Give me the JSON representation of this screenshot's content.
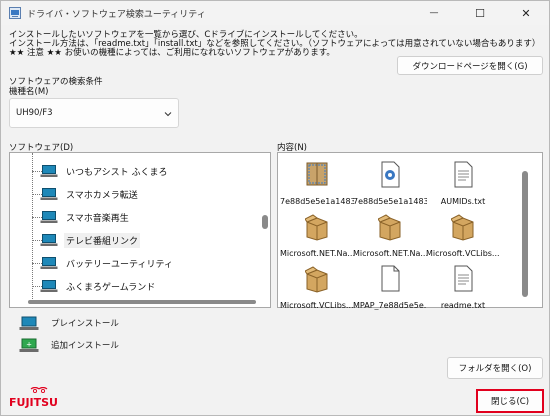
{
  "window": {
    "title": "ドライバ・ソフトウェア検索ユーティリティ",
    "minimize_glyph": "—",
    "maximize_glyph": "☐",
    "close_glyph": "✕"
  },
  "instructions": {
    "line1": "インストールしたいソフトウェアを一覧から選び、Cドライブにインストールしてください。",
    "line2": "インストール方法は、「readme.txt」「install.txt」などを参照してください。（ソフトウェアによっては用意されていない場合もあります）",
    "line3": "★★ 注意 ★★ お使いの機種によっては、ご利用になれないソフトウェアがあります。"
  },
  "buttons": {
    "download_page": "ダウンロードページを開く(G)",
    "open_folder": "フォルダを開く(O)",
    "close": "閉じる(C)"
  },
  "search": {
    "section_label": "ソフトウェアの検索条件",
    "model_label": "機種名(M)",
    "model_value": "UH90/F3"
  },
  "software": {
    "label": "ソフトウェア(D)",
    "items": [
      {
        "label": "いつもアシスト ふくまろ",
        "selected": false
      },
      {
        "label": "スマホカメラ転送",
        "selected": false
      },
      {
        "label": "スマホ音楽再生",
        "selected": false
      },
      {
        "label": "テレビ番組リンク",
        "selected": true
      },
      {
        "label": "バッテリーユーティリティ",
        "selected": false
      },
      {
        "label": "ふくまろゲームランド",
        "selected": false
      }
    ]
  },
  "contents": {
    "label": "内容(N)",
    "files": [
      {
        "name": "7e88d5e5e1a1483...",
        "icon": "package-icon"
      },
      {
        "name": "7e88d5e5e1a1483...",
        "icon": "settings-file-icon"
      },
      {
        "name": "AUMIDs.txt",
        "icon": "text-file-icon"
      },
      {
        "name": "Microsoft.NET.Na...",
        "icon": "box-icon"
      },
      {
        "name": "Microsoft.NET.Na...",
        "icon": "box-icon"
      },
      {
        "name": "Microsoft.VCLibs....",
        "icon": "box-icon"
      },
      {
        "name": "Microsoft.VCLibs....",
        "icon": "box-icon"
      },
      {
        "name": "MPAP_7e88d5e5e...",
        "icon": "blank-file-icon"
      },
      {
        "name": "readme.txt",
        "icon": "text-file-icon"
      }
    ]
  },
  "legend": {
    "preinstall": "プレインストール",
    "additional": "追加インストール"
  },
  "logo": {
    "text": "FUJITSU"
  },
  "colors": {
    "close_highlight": "#e1001e",
    "logo_red": "#e1001e",
    "laptop_screen": "#1e88b8"
  }
}
